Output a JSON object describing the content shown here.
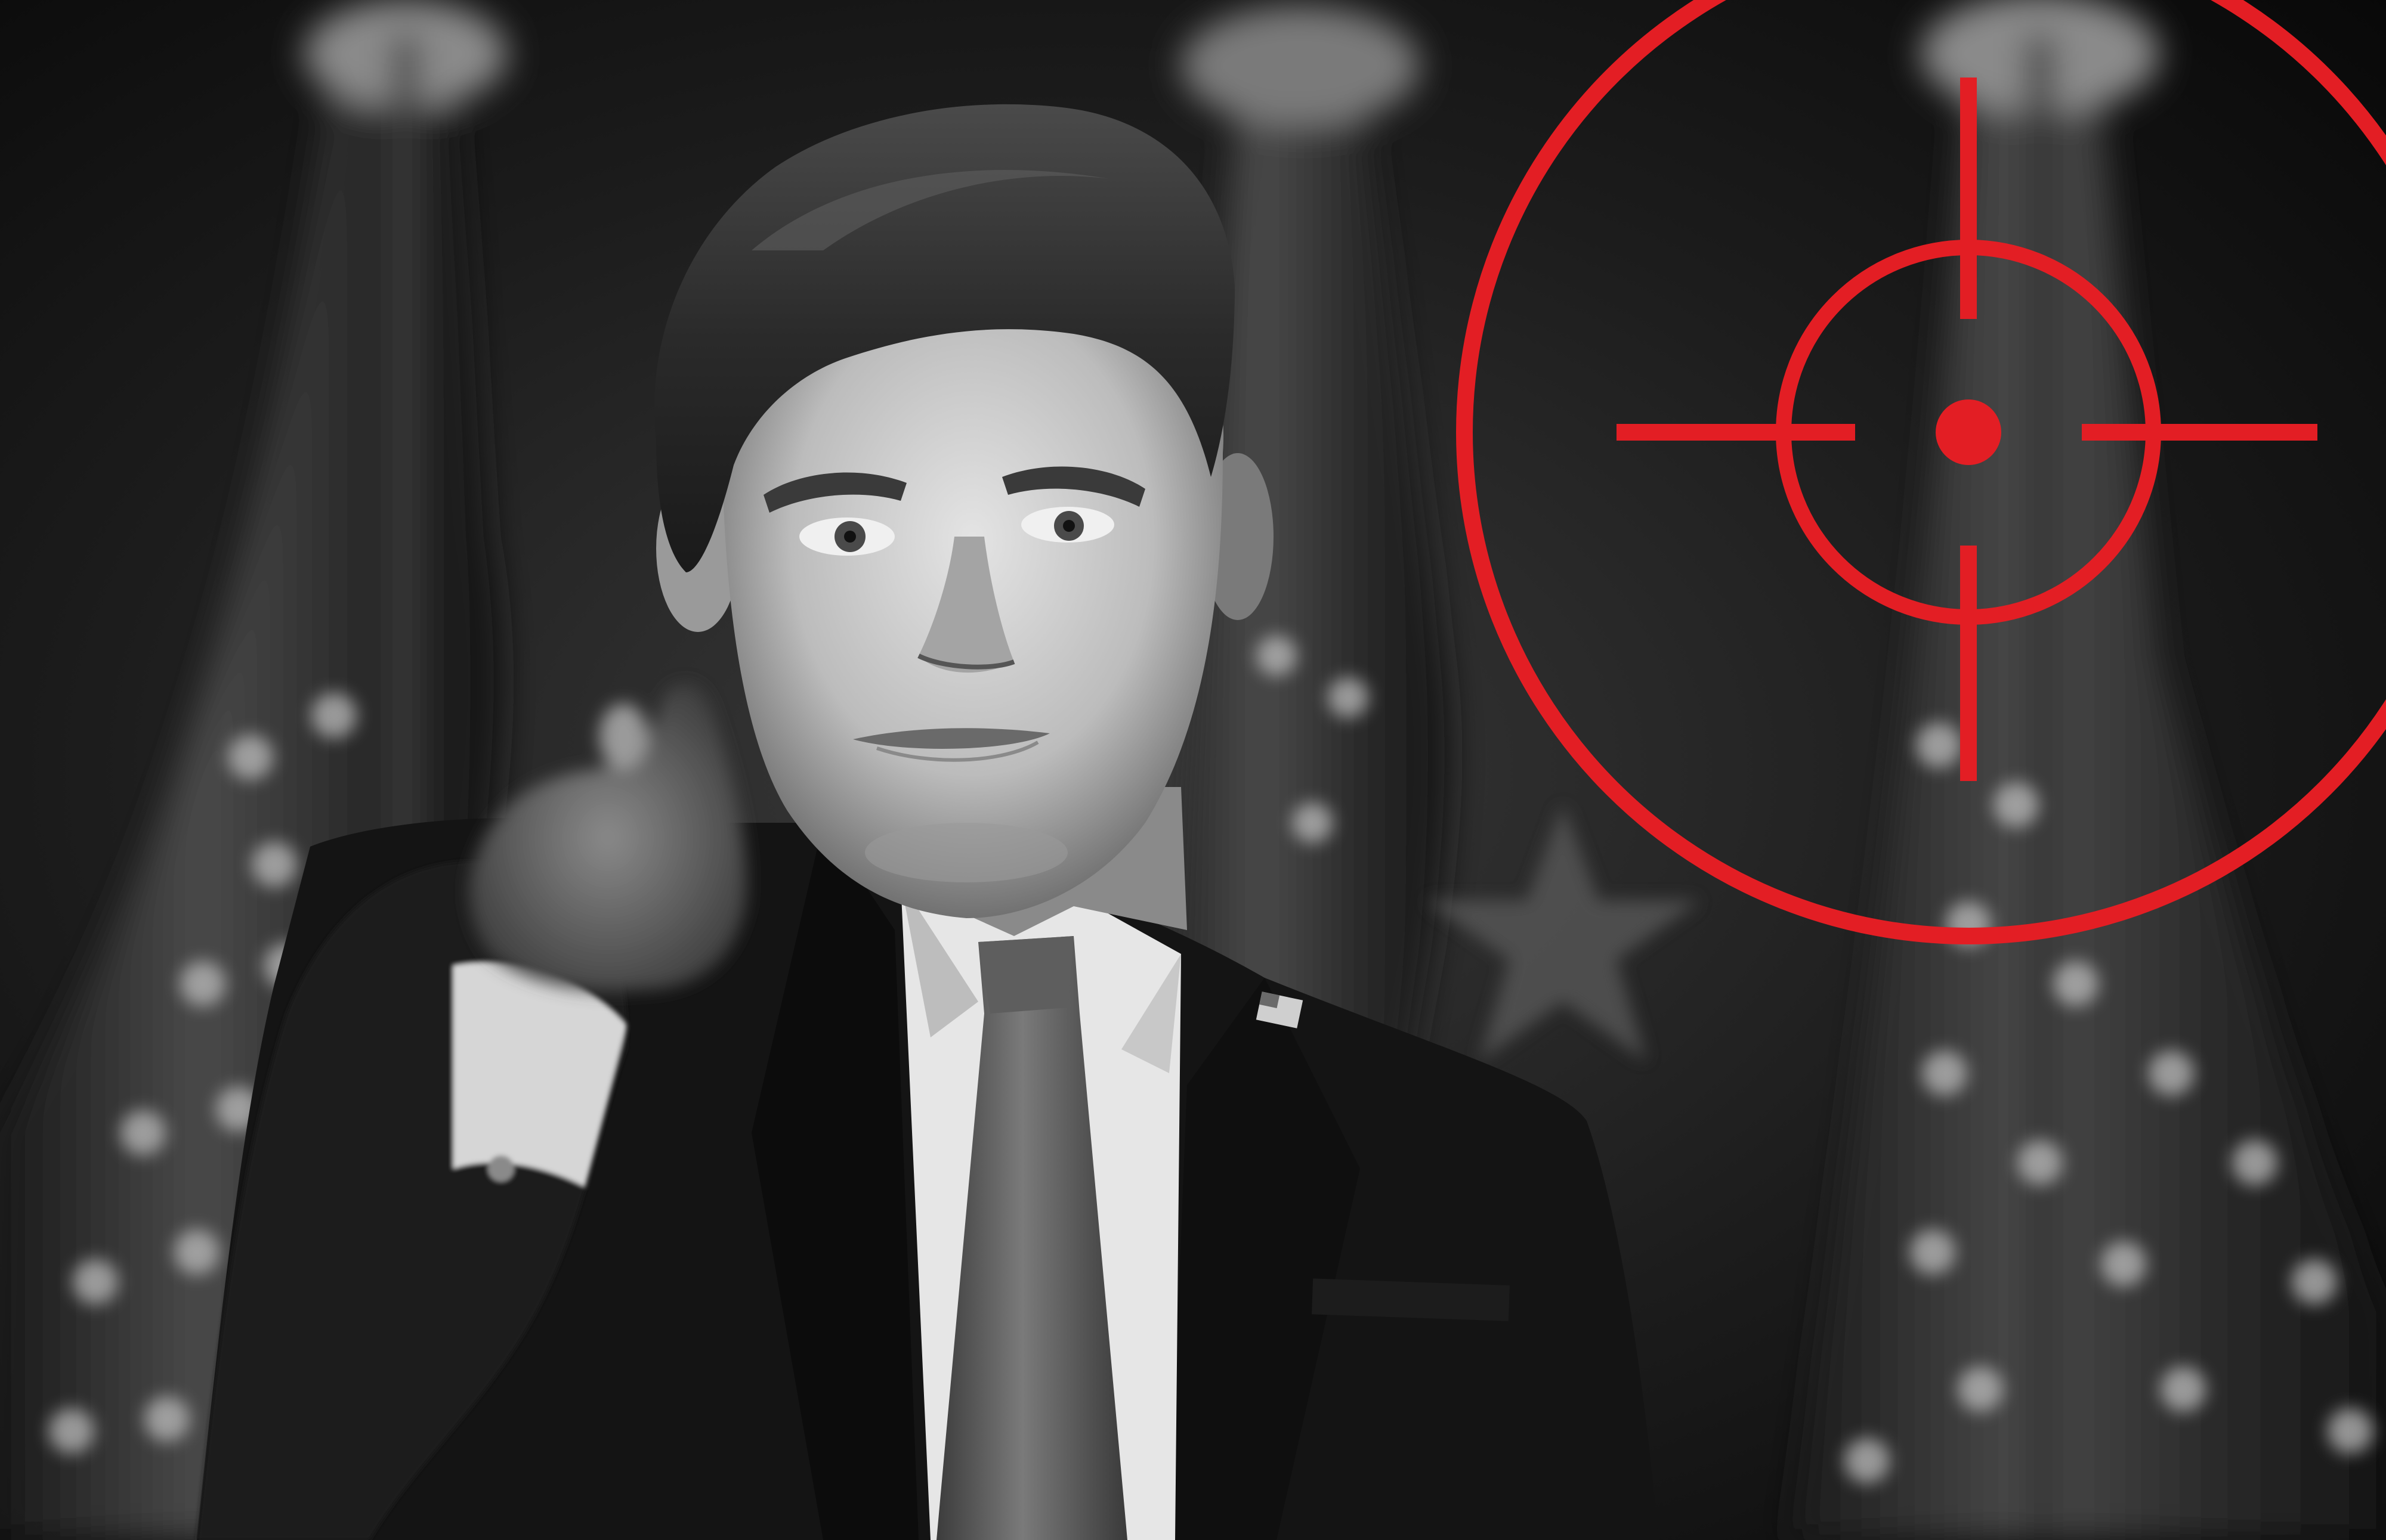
{
  "image": {
    "palette": {
      "background_dark": "#0d0d0d",
      "background_mid": "#2a2a2a",
      "suit": "#141414",
      "shirt": "#e6e6e6",
      "tie": "#5a5a5a",
      "skin_light": "#d9d9d9",
      "skin_shadow": "#7a7a7a",
      "hair": "#262626",
      "reticle_red": "#e31e24",
      "flag_stars": "#bdbdbd"
    },
    "elements": {
      "background": "dark-studio-background",
      "flags": "blurred-american-flags",
      "person": "man-in-suit-pointing",
      "face_mask": "face-mask",
      "lapel_pin": "american-flag-lapel-pin",
      "reticle": "red-crosshair-reticle"
    }
  }
}
